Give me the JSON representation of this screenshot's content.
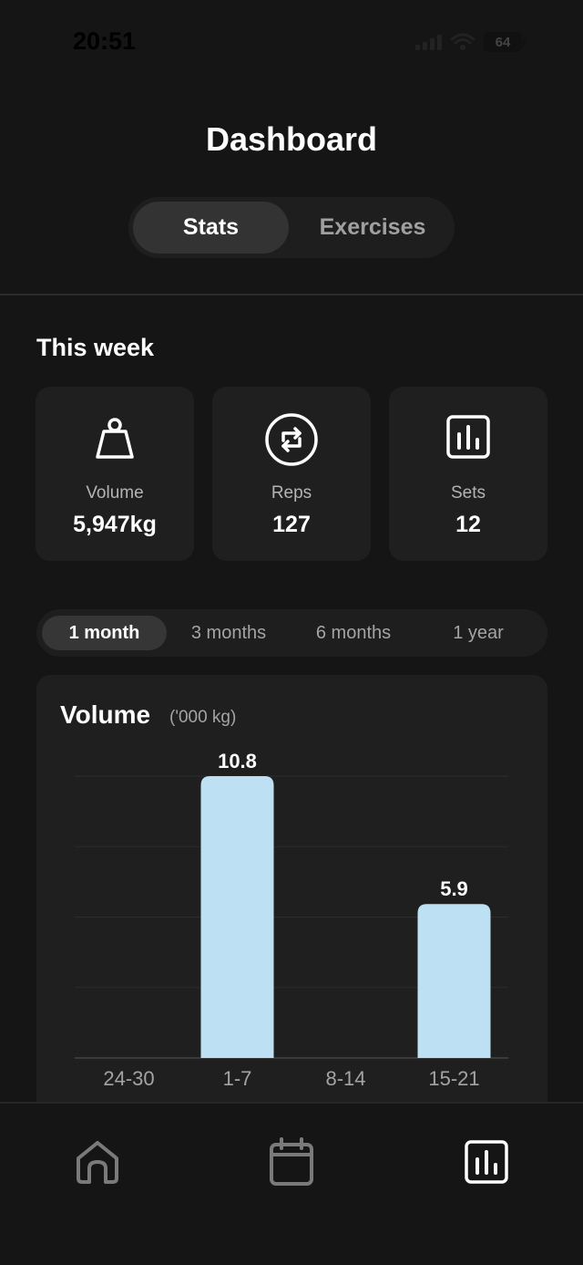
{
  "status_bar": {
    "time": "20:51",
    "battery": "64"
  },
  "header": {
    "title": "Dashboard",
    "tabs": [
      {
        "label": "Stats",
        "active": true
      },
      {
        "label": "Exercises",
        "active": false
      }
    ]
  },
  "week": {
    "title": "This week",
    "cards": [
      {
        "icon": "weight-icon",
        "label": "Volume",
        "value": "5,947kg"
      },
      {
        "icon": "repeat-icon",
        "label": "Reps",
        "value": "127"
      },
      {
        "icon": "bar-chart-icon",
        "label": "Sets",
        "value": "12"
      }
    ]
  },
  "range": {
    "options": [
      {
        "label": "1 month",
        "active": true
      },
      {
        "label": "3 months",
        "active": false
      },
      {
        "label": "6 months",
        "active": false
      },
      {
        "label": "1 year",
        "active": false
      }
    ]
  },
  "chart": {
    "title": "Volume",
    "unit": "('000 kg)"
  },
  "chart_data": {
    "type": "bar",
    "title": "Volume",
    "ylabel": "('000 kg)",
    "categories": [
      "24-30",
      "1-7",
      "8-14",
      "15-21"
    ],
    "values": [
      0,
      10.8,
      0,
      5.9
    ],
    "value_labels": [
      "",
      "10.8",
      "",
      "5.9"
    ],
    "ylim": [
      0,
      10.8
    ],
    "grid": true,
    "bar_color": "#bde0f2"
  },
  "nav": {
    "items": [
      {
        "icon": "home-icon",
        "active": false
      },
      {
        "icon": "calendar-icon",
        "active": false
      },
      {
        "icon": "stats-icon",
        "active": true
      }
    ]
  },
  "colors": {
    "background": "#151515",
    "card": "#1f1f1f",
    "accent_bar": "#bde0f2",
    "muted_text": "#a4a4a4"
  }
}
